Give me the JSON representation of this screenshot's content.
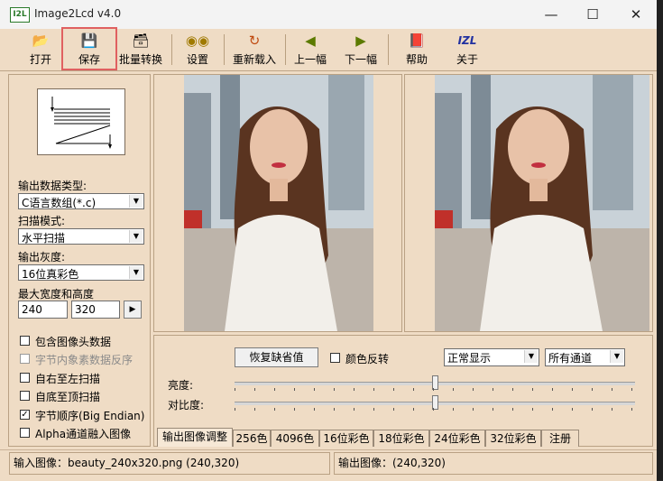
{
  "window": {
    "title": "Image2Lcd v4.0",
    "icon_text": "I2L"
  },
  "toolbar": {
    "buttons": [
      {
        "label": "打开",
        "icon": "open-icon"
      },
      {
        "label": "保存",
        "icon": "save-icon"
      },
      {
        "label": "批量转换",
        "icon": "batch-icon"
      },
      {
        "label": "设置",
        "icon": "settings-icon"
      },
      {
        "label": "重新载入",
        "icon": "reload-icon"
      },
      {
        "label": "上一幅",
        "icon": "arrow-left-icon"
      },
      {
        "label": "下一幅",
        "icon": "arrow-right-icon"
      },
      {
        "label": "帮助",
        "icon": "help-book-icon"
      },
      {
        "label": "关于",
        "icon": "about-izl-icon",
        "icon_text": "IZL"
      }
    ]
  },
  "left": {
    "output_type_label": "输出数据类型:",
    "output_type_value": "C语言数组(*.c)",
    "scan_mode_label": "扫描模式:",
    "scan_mode_value": "水平扫描",
    "gray_label": "输出灰度:",
    "gray_value": "16位真彩色",
    "size_label": "最大宽度和高度",
    "width_value": "240",
    "height_value": "320",
    "checkboxes": [
      {
        "label": "包含图像头数据",
        "checked": false,
        "enabled": true
      },
      {
        "label": "字节内象素数据反序",
        "checked": false,
        "enabled": false
      },
      {
        "label": "自右至左扫描",
        "checked": false,
        "enabled": true
      },
      {
        "label": "自底至顶扫描",
        "checked": false,
        "enabled": true
      },
      {
        "label": "字节顺序(Big Endian)",
        "checked": true,
        "enabled": true
      },
      {
        "label": "Alpha通道融入图像",
        "checked": false,
        "enabled": true
      }
    ]
  },
  "controls": {
    "restore_button": "恢复缺省值",
    "invert_label": "颜色反转",
    "display_mode": "正常显示",
    "channel": "所有通道",
    "brightness_label": "亮度:",
    "contrast_label": "对比度:",
    "brightness_level": 0.5,
    "contrast_level": 0.5
  },
  "tabs": [
    "输出图像调整",
    "256色",
    "4096色",
    "16位彩色",
    "18位彩色",
    "24位彩色",
    "32位彩色",
    "注册"
  ],
  "status": {
    "input": "输入图像：beauty_240x320.png (240,320)",
    "output": "输出图像：(240,320)"
  },
  "colors": {
    "panel": "#efdcc5",
    "highlight": "#e06060"
  }
}
